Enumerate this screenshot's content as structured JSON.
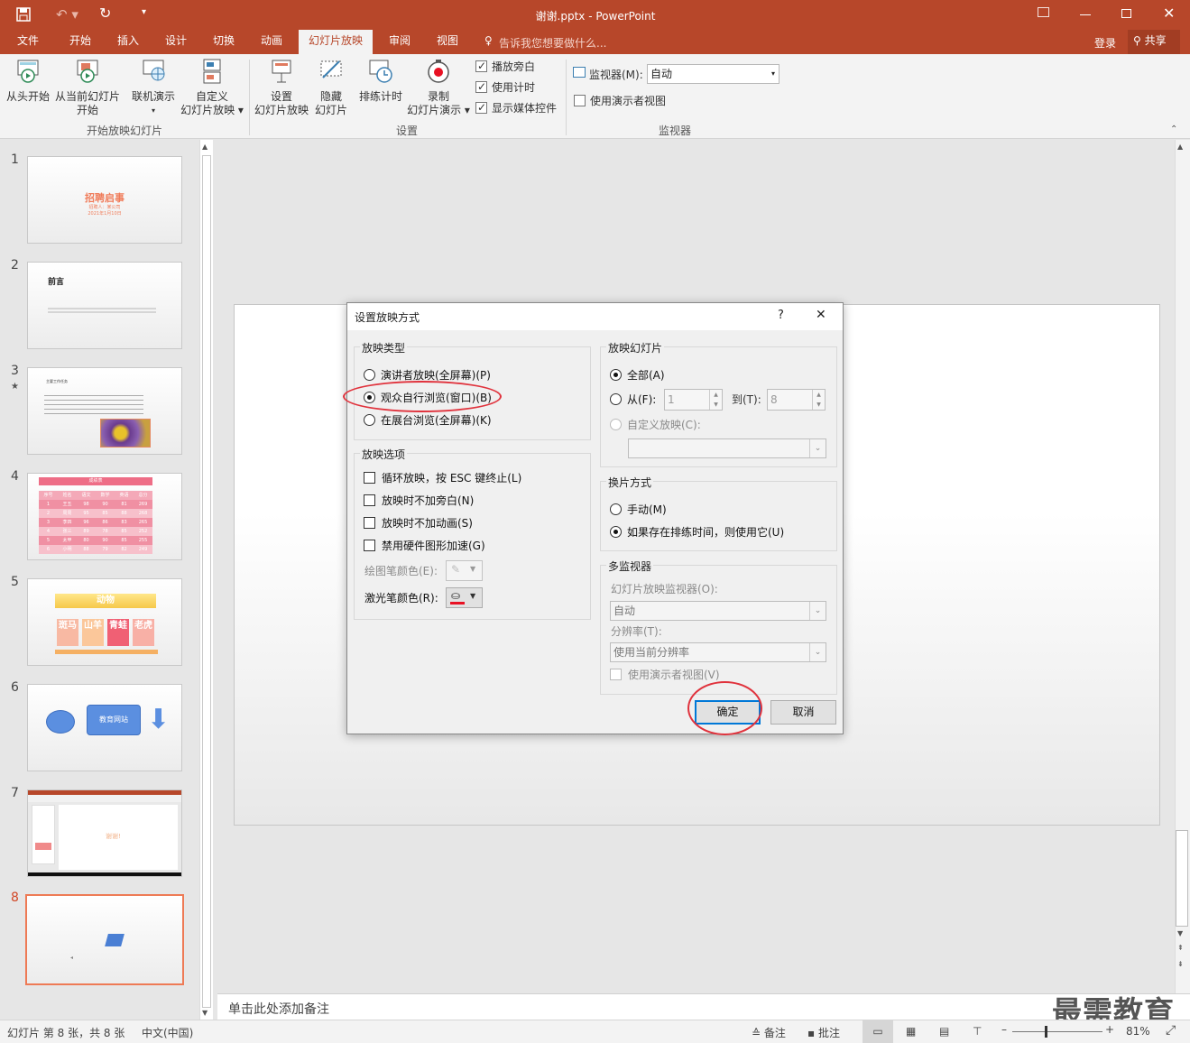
{
  "window": {
    "title": "谢谢.pptx - PowerPoint"
  },
  "qat": {
    "save": "save-icon",
    "undo": "undo-icon",
    "redo": "redo-icon",
    "customize": "▾"
  },
  "tabs": [
    {
      "label": "文件"
    },
    {
      "label": "开始"
    },
    {
      "label": "插入"
    },
    {
      "label": "设计"
    },
    {
      "label": "切换"
    },
    {
      "label": "动画"
    },
    {
      "label": "幻灯片放映"
    },
    {
      "label": "审阅"
    },
    {
      "label": "视图"
    }
  ],
  "tellme": "告诉我您想要做什么...",
  "account": {
    "signin": "登录",
    "share": "共享"
  },
  "ribbon": {
    "from_start": "从头开始",
    "from_current_1": "从当前幻灯片",
    "from_current_2": "开始",
    "online": "联机演示",
    "custom_1": "自定义",
    "custom_2": "幻灯片放映",
    "group1": "开始放映幻灯片",
    "setup_1": "设置",
    "setup_2": "幻灯片放映",
    "hide_1": "隐藏",
    "hide_2": "幻灯片",
    "rehearse": "排练计时",
    "record_1": "录制",
    "record_2": "幻灯片演示",
    "chk_narration": "播放旁白",
    "chk_timings": "使用计时",
    "chk_media": "显示媒体控件",
    "group2": "设置",
    "monitor_label": "监视器(M):",
    "monitor_value": "自动",
    "presenter_view": "使用演示者视图",
    "group3": "监视器"
  },
  "thumbs": {
    "nums": [
      "1",
      "2",
      "3",
      "4",
      "5",
      "6",
      "7",
      "8"
    ],
    "s1_title": "招聘启事",
    "s1_sub": "招聘人：某公司",
    "s1_date": "2021年1月10日",
    "s2_title": "前言",
    "s3_title": "主要工作任务",
    "s4_title": "成绩表",
    "s4_headers": [
      "序号",
      "姓名",
      "语文",
      "数学",
      "英语",
      "总分"
    ],
    "s4_rows": [
      [
        "1",
        "王五",
        "98",
        "90",
        "81",
        "269"
      ],
      [
        "2",
        "周周",
        "95",
        "85",
        "88",
        "268"
      ],
      [
        "3",
        "李四",
        "96",
        "86",
        "83",
        "265"
      ],
      [
        "4",
        "张三",
        "89",
        "78",
        "85",
        "252"
      ],
      [
        "5",
        "太甲",
        "80",
        "90",
        "85",
        "255"
      ],
      [
        "6",
        "小明",
        "88",
        "79",
        "82",
        "249"
      ]
    ],
    "s5_title": "动物",
    "s5_cells": [
      "斑马",
      "山羊",
      "青蛙",
      "老虎"
    ],
    "s6_box": "教育网站",
    "s7_text": "谢谢!"
  },
  "notes": "单击此处添加备注",
  "status": {
    "slide_info": "幻灯片 第 8 张，共 8 张",
    "lang": "中文(中国)",
    "notes": "备注",
    "comments": "批注",
    "zoom": "81%"
  },
  "watermark": "最需教育",
  "dialog": {
    "title": "设置放映方式",
    "help": "?",
    "close": "✕",
    "type_legend": "放映类型",
    "type_opts": [
      "演讲者放映(全屏幕)(P)",
      "观众自行浏览(窗口)(B)",
      "在展台浏览(全屏幕)(K)"
    ],
    "show_legend": "放映选项",
    "show_opts": [
      "循环放映，按 ESC 键终止(L)",
      "放映时不加旁白(N)",
      "放映时不加动画(S)",
      "禁用硬件图形加速(G)"
    ],
    "pen_color": "绘图笔颜色(E):",
    "laser_color": "激光笔颜色(R):",
    "slides_legend": "放映幻灯片",
    "slides_all": "全部(A)",
    "slides_from": "从(F):",
    "from_value": "1",
    "slides_to": "到(T):",
    "to_value": "8",
    "custom_show": "自定义放映(C):",
    "advance_legend": "换片方式",
    "advance_manual": "手动(M)",
    "advance_timings": "如果存在排练时间，则使用它(U)",
    "multi_legend": "多监视器",
    "monitor_label": "幻灯片放映监视器(O):",
    "monitor_value": "自动",
    "resolution_label": "分辨率(T):",
    "resolution_value": "使用当前分辨率",
    "presenter_view": "使用演示者视图(V)",
    "ok": "确定",
    "cancel": "取消"
  },
  "colors": {
    "accent": "#b7472a",
    "highlight_ring": "#e0323c",
    "laser": "#e81123"
  }
}
